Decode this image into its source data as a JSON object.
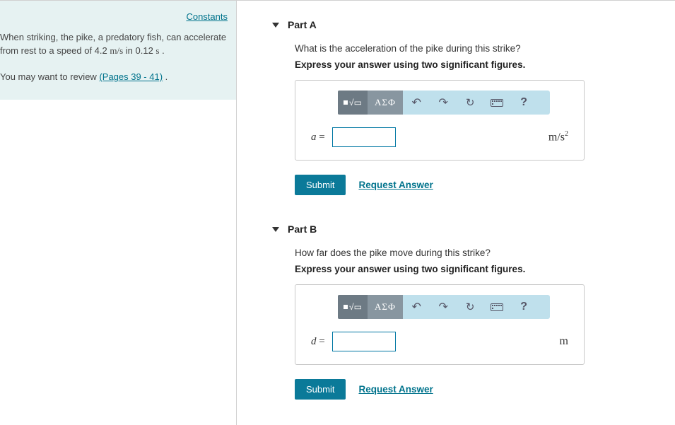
{
  "sidebar": {
    "constants_link": "Constants",
    "problem_text_1": "When striking, the pike, a predatory fish, can accelerate from rest to a speed of 4.2 ",
    "problem_units": "m/s",
    "problem_text_2": " in 0.12 ",
    "problem_units2": "s",
    "problem_text_3": " .",
    "review_prefix": "You may want to review ",
    "review_link": "(Pages 39 - 41)",
    "review_suffix": " ."
  },
  "parts": {
    "a": {
      "title": "Part A",
      "question": "What is the acceleration of the pike during this strike?",
      "instruction": "Express your answer using two significant figures.",
      "var": "a",
      "unit_html": "m/s²",
      "submit": "Submit",
      "request": "Request Answer",
      "greek": "ΑΣФ",
      "help": "?"
    },
    "b": {
      "title": "Part B",
      "question": "How far does the pike move during this strike?",
      "instruction": "Express your answer using two significant figures.",
      "var": "d",
      "unit_html": "m",
      "submit": "Submit",
      "request": "Request Answer",
      "greek": "ΑΣФ",
      "help": "?"
    }
  }
}
